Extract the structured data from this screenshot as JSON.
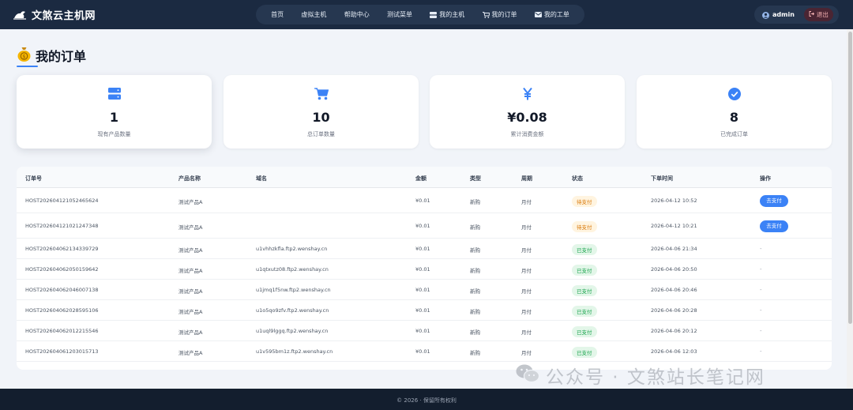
{
  "brand": {
    "name": "文煞云主机网",
    "icon": "cloud-plane-icon"
  },
  "nav": [
    {
      "label": "首页",
      "icon": ""
    },
    {
      "label": "虚拟主机",
      "icon": ""
    },
    {
      "label": "帮助中心",
      "icon": ""
    },
    {
      "label": "测试菜单",
      "icon": ""
    },
    {
      "label": "我的主机",
      "icon": "server-icon"
    },
    {
      "label": "我的订单",
      "icon": "cart-icon"
    },
    {
      "label": "我的工单",
      "icon": "ticket-icon"
    }
  ],
  "user": {
    "name": "admin",
    "logout_label": "退出"
  },
  "page": {
    "title": "我的订单",
    "title_icon": "money-bag-icon"
  },
  "stats": [
    {
      "value": "1",
      "label": "现有产品数量",
      "icon": "server-icon"
    },
    {
      "value": "10",
      "label": "总订单数量",
      "icon": "cart-icon"
    },
    {
      "value": "¥0.08",
      "label": "累计消费金额",
      "icon": "yen-icon"
    },
    {
      "value": "8",
      "label": "已完成订单",
      "icon": "check-circle-icon"
    }
  ],
  "table": {
    "headers": [
      "订单号",
      "产品名称",
      "域名",
      "金额",
      "类型",
      "周期",
      "状态",
      "下单时间",
      "操作"
    ],
    "rows": [
      {
        "order": "HOST20260412105246562​4",
        "product": "测试产品A",
        "domain": "",
        "amount": "¥0.01",
        "type": "新购",
        "cycle": "月付",
        "status": "待支付",
        "status_kind": "pending",
        "time": "2026-04-12 10:52",
        "action": "去支付"
      },
      {
        "order": "HOST20260412102124734​8",
        "product": "测试产品A",
        "domain": "",
        "amount": "¥0.01",
        "type": "新购",
        "cycle": "月付",
        "status": "待支付",
        "status_kind": "pending",
        "time": "2026-04-12 10:21",
        "action": "去支付"
      },
      {
        "order": "HOST20260406213433972​9",
        "product": "测试产品A",
        "domain": "u1vhhzkfla.ftp2.wenshay.cn",
        "amount": "¥0.01",
        "type": "新购",
        "cycle": "月付",
        "status": "已支付",
        "status_kind": "paid",
        "time": "2026-04-06 21:34",
        "action": "-"
      },
      {
        "order": "HOST20260406205015964​2",
        "product": "测试产品A",
        "domain": "u1qtxutz08.ftp2.wenshay.cn",
        "amount": "¥0.01",
        "type": "新购",
        "cycle": "月付",
        "status": "已支付",
        "status_kind": "paid",
        "time": "2026-04-06 20:50",
        "action": "-"
      },
      {
        "order": "HOST20260406204600713​8",
        "product": "测试产品A",
        "domain": "u1jmq1f5nw.ftp2.wenshay.cn",
        "amount": "¥0.01",
        "type": "新购",
        "cycle": "月付",
        "status": "已支付",
        "status_kind": "paid",
        "time": "2026-04-06 20:46",
        "action": "-"
      },
      {
        "order": "HOST20260406202859510​6",
        "product": "测试产品A",
        "domain": "u1o5qo9zfv.ftp2.wenshay.cn",
        "amount": "¥0.01",
        "type": "新购",
        "cycle": "月付",
        "status": "已支付",
        "status_kind": "paid",
        "time": "2026-04-06 20:28",
        "action": "-"
      },
      {
        "order": "HOST20260406201221554​6",
        "product": "测试产品A",
        "domain": "u1uql9lggq.ftp2.wenshay.cn",
        "amount": "¥0.01",
        "type": "新购",
        "cycle": "月付",
        "status": "已支付",
        "status_kind": "paid",
        "time": "2026-04-06 20:12",
        "action": "-"
      },
      {
        "order": "HOST20260406120301571​3",
        "product": "测试产品A",
        "domain": "u1v595bm1z.ftp2.wenshay.cn",
        "amount": "¥0.01",
        "type": "新购",
        "cycle": "月付",
        "status": "已支付",
        "status_kind": "paid",
        "time": "2026-04-06 12:03",
        "action": "-"
      }
    ]
  },
  "footer": {
    "text": "© 2026 · 保留所有权利"
  },
  "watermark": {
    "text": "公众号 · 文煞站长笔记网",
    "icon": "wechat-icon"
  },
  "colors": {
    "header": "#1b2a41",
    "accent": "#3b82f6",
    "pending": "#d97706",
    "paid": "#16a34a"
  }
}
